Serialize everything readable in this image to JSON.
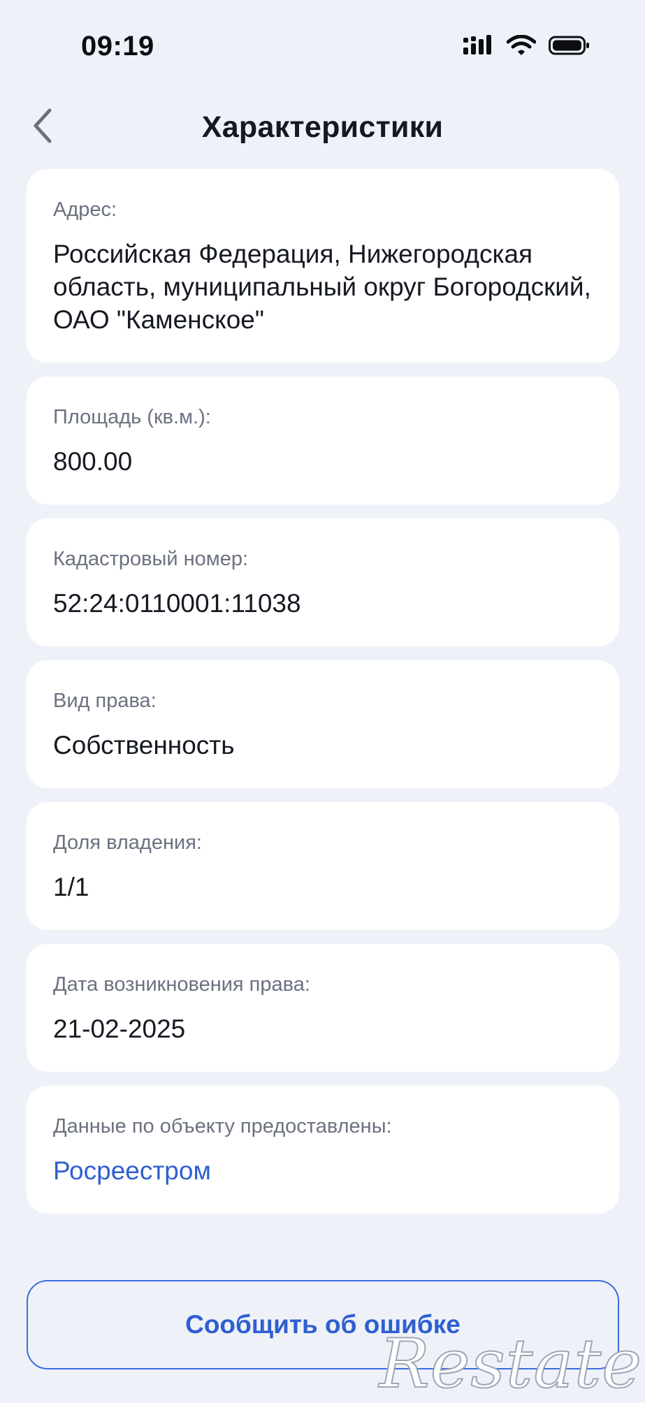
{
  "status_bar": {
    "time": "09:19",
    "icons": [
      "cellular-signal-icon",
      "wifi-icon",
      "battery-icon"
    ]
  },
  "header": {
    "title": "Характеристики",
    "back_icon": "chevron-left-icon"
  },
  "cards": [
    {
      "label": "Адрес:",
      "value": "Российская Федерация, Нижегородская область, муниципальный округ Богородский, ОАО \"Каменское\""
    },
    {
      "label": "Площадь (кв.м.):",
      "value": "800.00"
    },
    {
      "label": "Кадастровый номер:",
      "value": "52:24:0110001:11038"
    },
    {
      "label": "Вид права:",
      "value": "Собственность"
    },
    {
      "label": "Доля владения:",
      "value": "1/1"
    },
    {
      "label": "Дата возникновения права:",
      "value": "21-02-2025"
    },
    {
      "label": "Данные по объекту предоставлены:",
      "value": "Росреестром"
    }
  ],
  "actions": {
    "report_error_label": "Сообщить об ошибке"
  },
  "watermark": {
    "text": "Restate"
  },
  "colors": {
    "background": "#eef2f8",
    "card": "#ffffff",
    "accent": "#2f5fd0",
    "label": "#6b7180",
    "text": "#151922"
  }
}
